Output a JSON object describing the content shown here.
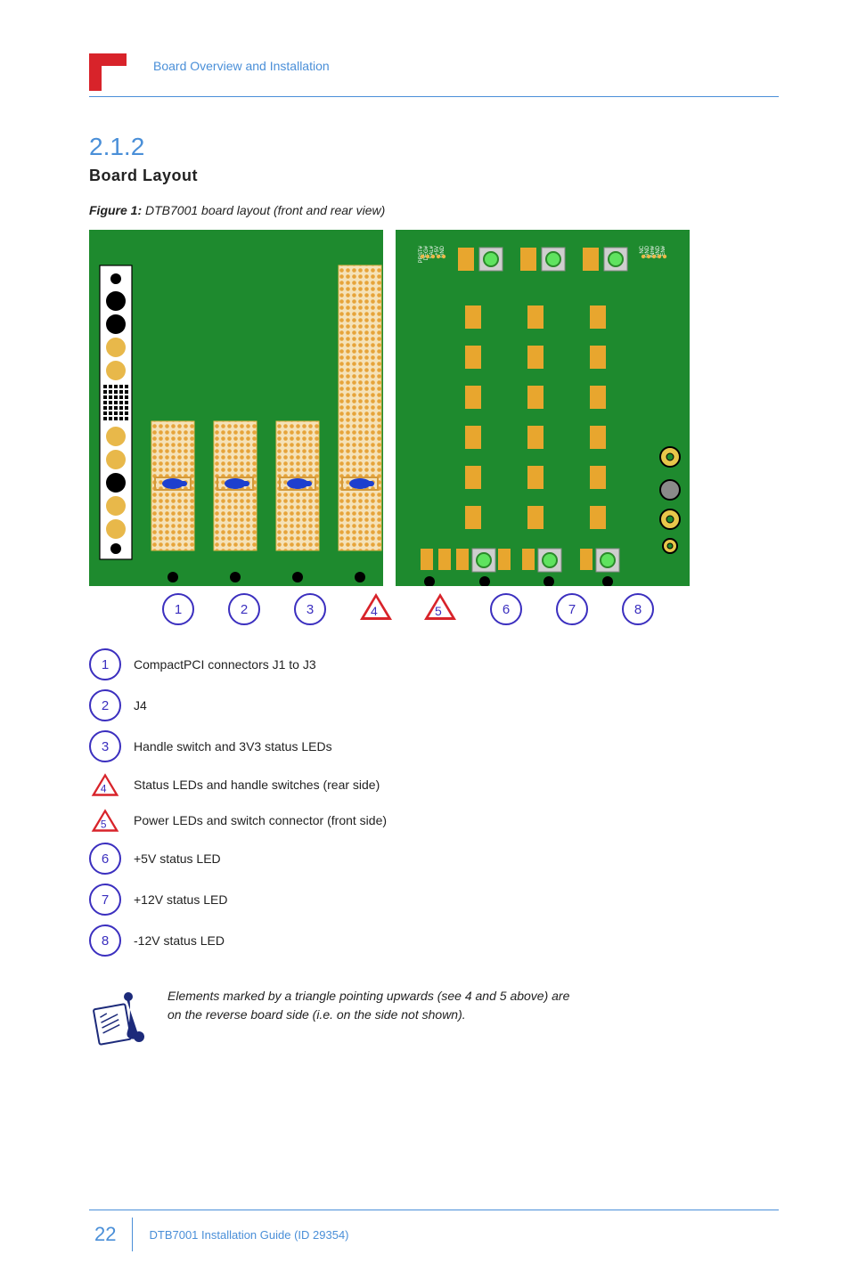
{
  "header": {
    "breadcrumb": "Board Overview and Installation"
  },
  "section": {
    "number": "2.1.2",
    "title": "Board Layout"
  },
  "figure": {
    "caption_prefix": "Figure 1:",
    "caption": "DTB7001 board layout (front and rear view)"
  },
  "board_left": {
    "pin_labels": [
      "PRST#",
      "DEG#",
      "FAL#",
      "+5V",
      "GND"
    ],
    "pin_labels_right": [
      "NC",
      "GND",
      "INH#",
      "GND",
      "EN#"
    ],
    "voltage_labels": [
      "-12V",
      "+12V"
    ]
  },
  "markers": {
    "left": [
      {
        "shape": "circle",
        "label": "1"
      },
      {
        "shape": "circle",
        "label": "2"
      },
      {
        "shape": "circle",
        "label": "3"
      },
      {
        "shape": "triangle",
        "label": "4"
      }
    ],
    "right": [
      {
        "shape": "triangle",
        "label": "5"
      },
      {
        "shape": "circle",
        "label": "6"
      },
      {
        "shape": "circle",
        "label": "7"
      },
      {
        "shape": "circle",
        "label": "8"
      }
    ]
  },
  "legend": {
    "rows": [
      {
        "n": "1",
        "shape": "circle",
        "text": "CompactPCI connectors J1 to J3"
      },
      {
        "n": "2",
        "shape": "circle",
        "text": "J4"
      },
      {
        "n": "3",
        "shape": "circle",
        "text": "Handle switch and 3V3 status LEDs"
      },
      {
        "n": "4",
        "shape": "triangle",
        "text": "Status LEDs and handle switches (rear side)"
      },
      {
        "n": "5",
        "shape": "triangle",
        "text": "Power LEDs and switch connector (front side)"
      },
      {
        "n": "6",
        "shape": "circle",
        "text": "+5V status LED"
      },
      {
        "n": "7",
        "shape": "circle",
        "text": "+12V status LED"
      },
      {
        "n": "8",
        "shape": "circle",
        "text": "-12V status LED"
      }
    ]
  },
  "note": {
    "line1": "Elements marked by a triangle pointing upwards (see 4 and 5 above) are",
    "line2": "on the reverse board side (i.e. on the side not shown)."
  },
  "footer": {
    "page": "22",
    "text": "DTB7001 Installation Guide (ID 29354)"
  }
}
